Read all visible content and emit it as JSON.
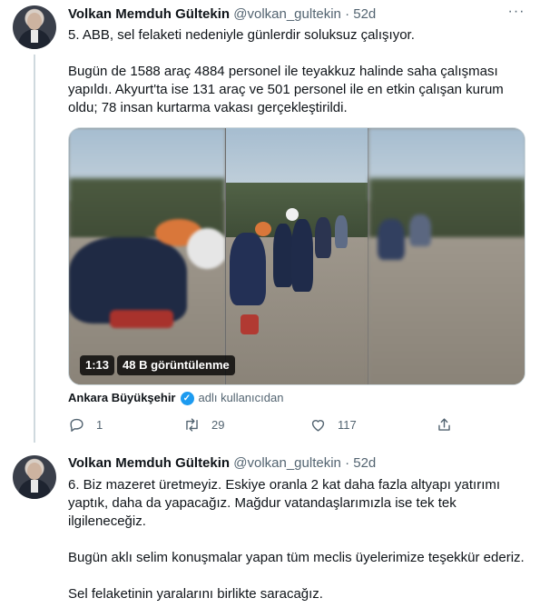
{
  "tweets": [
    {
      "author_name": "Volkan Memduh Gültekin",
      "handle": "@volkan_gultekin",
      "separator": "·",
      "time": "52d",
      "paragraphs": [
        "5. ABB, sel felaketi nedeniyle günlerdir soluksuz çalışıyor.",
        "Bugün de 1588 araç 4884 personel ile teyakkuz halinde saha çalışması yapıldı. Akyurt'ta ise 131 araç ve 501 personel ile en etkin çalışan kurum oldu; 78 insan kurtarma vakası gerçekleştirildi."
      ],
      "video": {
        "duration": "1:13",
        "views": "48 B görüntülenme"
      },
      "attribution": {
        "org": "Ankara Büyükşehir",
        "suffix": "adlı kullanıcıdan"
      },
      "actions": {
        "reply_count": "1",
        "retweet_count": "29",
        "like_count": "117"
      }
    },
    {
      "author_name": "Volkan Memduh Gültekin",
      "handle": "@volkan_gultekin",
      "separator": "·",
      "time": "52d",
      "paragraphs": [
        "6. Biz mazeret üretmeyiz. Eskiye oranla 2 kat daha fazla altyapı yatırımı yaptık, daha da yapacağız. Mağdur vatandaşlarımızla ise tek tek ilgileneceğiz.",
        "Bugün aklı selim konuşmalar yapan tüm meclis üyelerimize teşekkür ederiz.",
        "Sel felaketinin yaralarını birlikte saracağız."
      ]
    }
  ],
  "icons": {
    "more": "more-horizontal-icon",
    "verified": "verified-badge-icon",
    "reply": "reply-icon",
    "retweet": "retweet-icon",
    "like": "heart-icon",
    "share": "share-icon"
  },
  "colors": {
    "text": "#0f1419",
    "secondary": "#536471",
    "verified": "#1d9bf0",
    "divider": "#cfd9de"
  }
}
